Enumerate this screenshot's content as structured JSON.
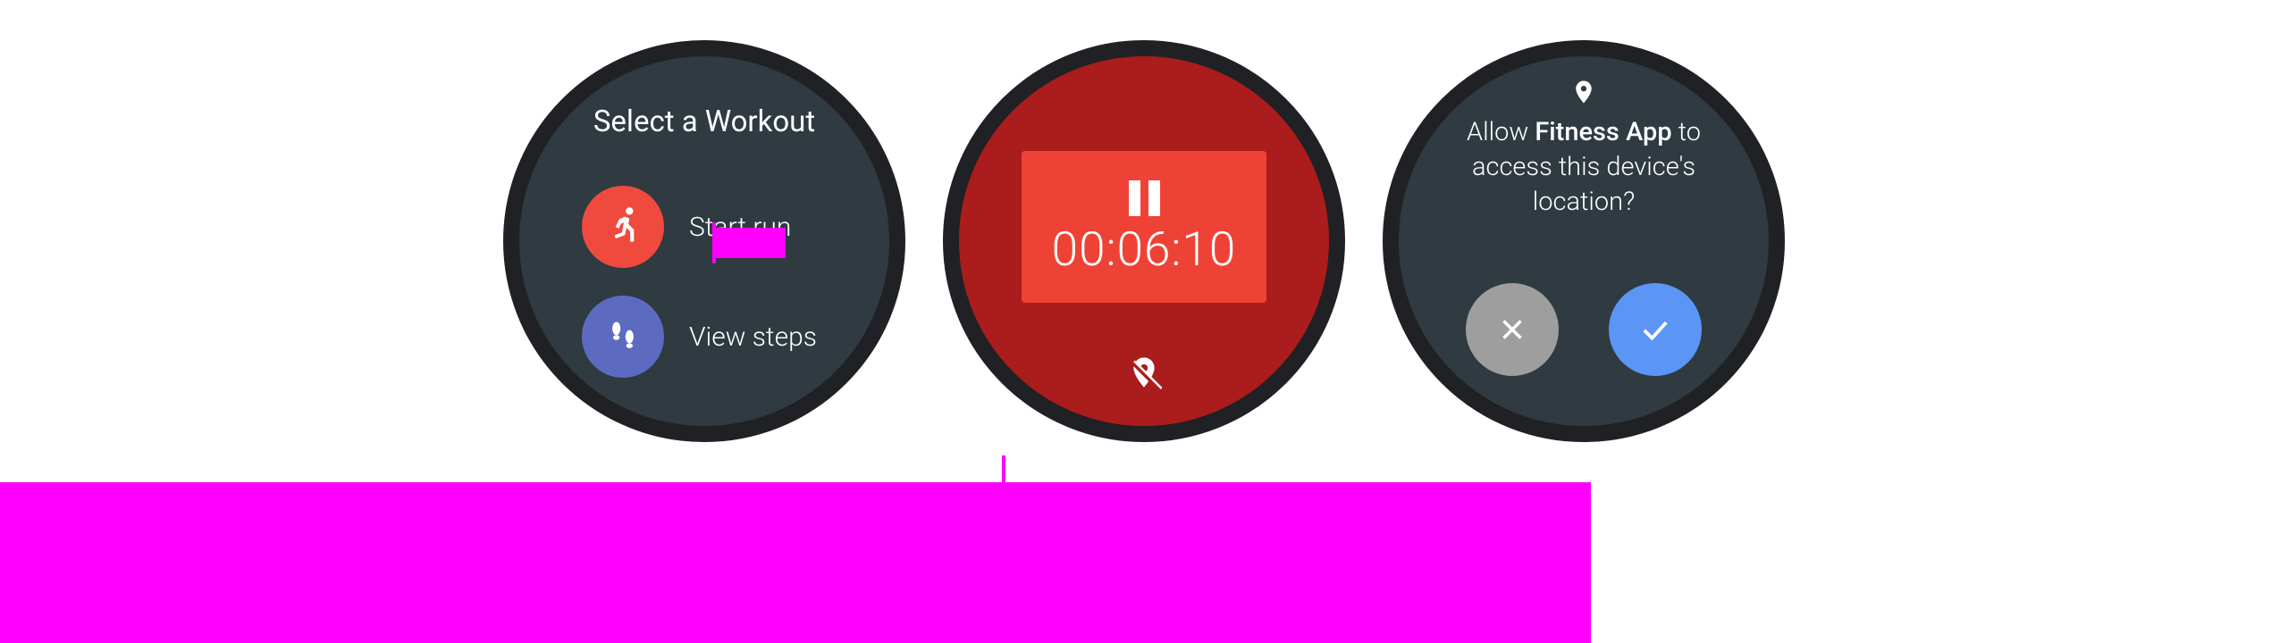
{
  "watch1": {
    "title": "Select a Workout",
    "items": [
      {
        "label": "Start run"
      },
      {
        "label": "View steps"
      }
    ]
  },
  "watch2": {
    "timer": "00:06:10"
  },
  "watch3": {
    "prompt_prefix": "Allow ",
    "app_name": "Fitness App",
    "prompt_suffix": " to access this device's location?"
  }
}
